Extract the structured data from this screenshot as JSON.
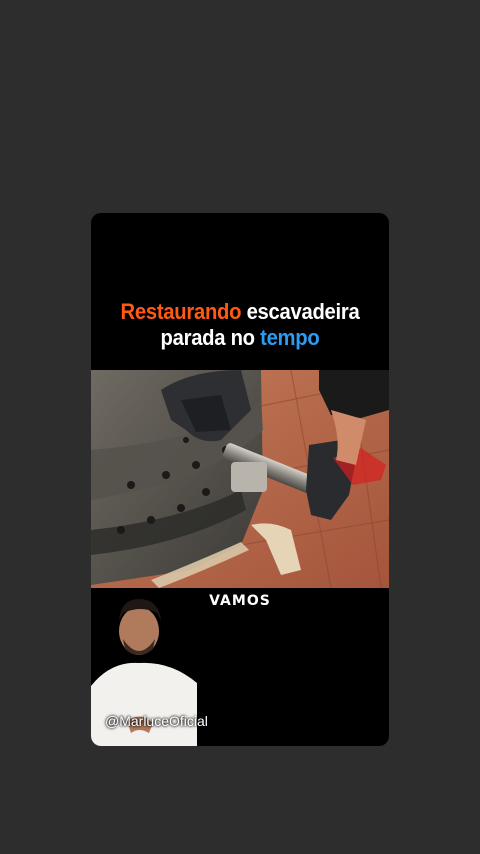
{
  "overlay": {
    "title_line1_highlight": "Restaurando",
    "title_line1_rest": " escavadeira",
    "title_line2_start": "parada no ",
    "title_line2_highlight": "tempo",
    "caption": "VAMOS",
    "creator_handle": "@MarluceOficial"
  },
  "colors": {
    "page_background": "#2d2d2d",
    "card_background": "#000000",
    "title_text": "#ffffff",
    "title_highlight_orange": "#ff5a14",
    "title_highlight_blue": "#2b9cf2"
  }
}
